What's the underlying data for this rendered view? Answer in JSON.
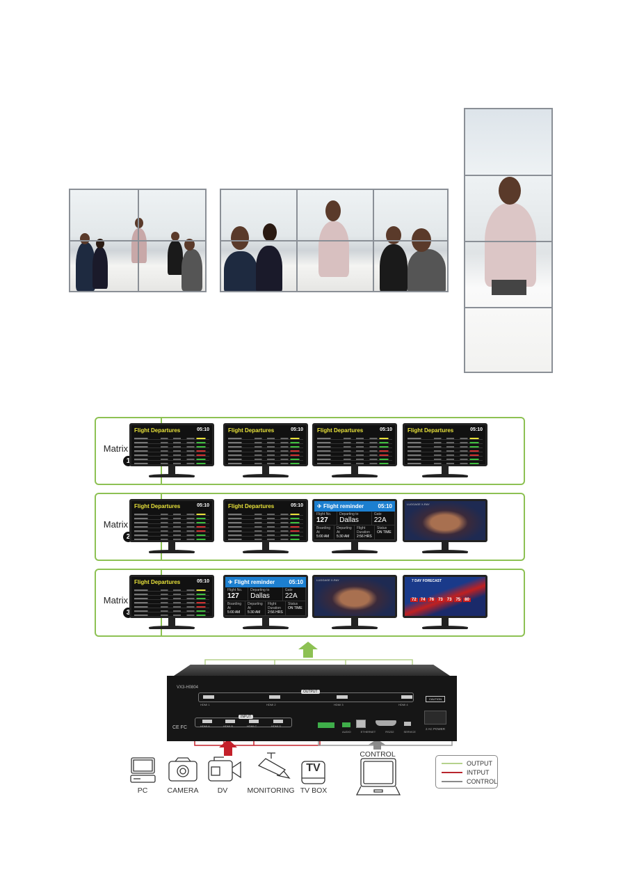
{
  "video_walls": [
    {
      "layout": "2x2"
    },
    {
      "layout": "3x2"
    },
    {
      "layout": "1x4"
    }
  ],
  "modes": [
    {
      "label": "Matrix Mode",
      "number": "1",
      "screens": [
        "departures",
        "departures",
        "departures",
        "departures"
      ]
    },
    {
      "label": "Matrix Mode",
      "number": "2",
      "screens": [
        "departures",
        "departures",
        "reminder",
        "luggage"
      ]
    },
    {
      "label": "Matrix Mode",
      "number": "3",
      "screens": [
        "departures",
        "reminder",
        "luggage",
        "weather"
      ]
    }
  ],
  "screens": {
    "departures": {
      "title": "Flight Departures",
      "time": "05:10"
    },
    "reminder": {
      "title": "Flight reminder",
      "time": "05:10",
      "flight_no_label": "Flight No.",
      "flight_no": "127",
      "departing_label": "Departing to",
      "departing": "Dallas",
      "gate_label": "Gate",
      "gate": "22A",
      "boarding_label": "Boarding At",
      "boarding": "5:00 AM",
      "dep_label": "Departing At",
      "dep": "5:30 AM",
      "duration_label": "Flight Duration",
      "duration": "2:56 HRS",
      "status_label": "Status",
      "status": "ON TIME"
    },
    "luggage": {
      "title": "LUGGAGE X-RAY"
    },
    "weather": {
      "title": "7 DAY FORECAST",
      "temps": [
        "72",
        "74",
        "76",
        "73",
        "73",
        "75",
        "80"
      ]
    }
  },
  "device": {
    "model": "VX3-H0804",
    "output_label": "OUTPUT",
    "outputs": [
      "HDMI 1",
      "HDMI 2",
      "HDMI 3",
      "HDMI 4"
    ],
    "input_label": "INPUT",
    "inputs": [
      "HDMI A",
      "HDMI B",
      "HDMI C",
      "HDMI D"
    ],
    "ports": [
      "AUDIO",
      "ETHERNET",
      "RS232",
      "SERVICE"
    ],
    "power": "2 AC POWER",
    "caution": "CAUTION",
    "cert": "CE FC"
  },
  "sources": [
    {
      "label": "PC",
      "icon": "pc-icon"
    },
    {
      "label": "CAMERA",
      "icon": "camera-icon"
    },
    {
      "label": "DV",
      "icon": "camcorder-icon"
    },
    {
      "label": "MONITORING",
      "icon": "cctv-icon"
    },
    {
      "label": "TV BOX",
      "icon": "tv-box-icon",
      "glyph": "TV"
    }
  ],
  "control": {
    "label": "CONTROL",
    "icon": "laptop-icon"
  },
  "legend": [
    {
      "label": "OUTPUT",
      "color": "#b5d28c"
    },
    {
      "label": "INTPUT",
      "color": "#b8262d"
    },
    {
      "label": "CONTROL",
      "color": "#8a8a8a"
    }
  ],
  "colors": {
    "output": "#8dc153",
    "input": "#c4202a",
    "control": "#8a8a8a"
  }
}
